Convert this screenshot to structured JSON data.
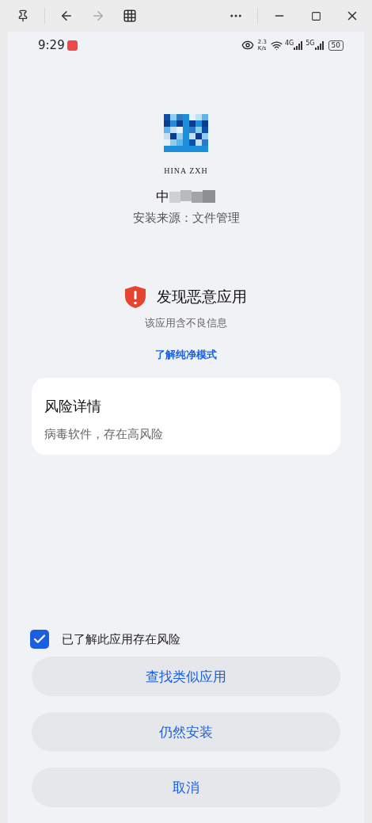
{
  "status_bar": {
    "time": "9:29",
    "speed_value": "2.3",
    "speed_unit": "K/s",
    "network_1": "4G",
    "network_2": "5G",
    "battery": "50"
  },
  "app": {
    "logo_caption": "HINA  ZXH",
    "name": "中",
    "source": "安装来源：文件管理"
  },
  "warning": {
    "title": "发现恶意应用",
    "subtitle": "该应用含不良信息",
    "link": "了解纯净模式"
  },
  "risk_card": {
    "title": "风险详情",
    "detail": "病毒软件，存在高风险"
  },
  "consent": {
    "label": "已了解此应用存在风险",
    "checked": true
  },
  "buttons": [
    {
      "label": "查找类似应用"
    },
    {
      "label": "仍然安装"
    },
    {
      "label": "取消"
    }
  ]
}
